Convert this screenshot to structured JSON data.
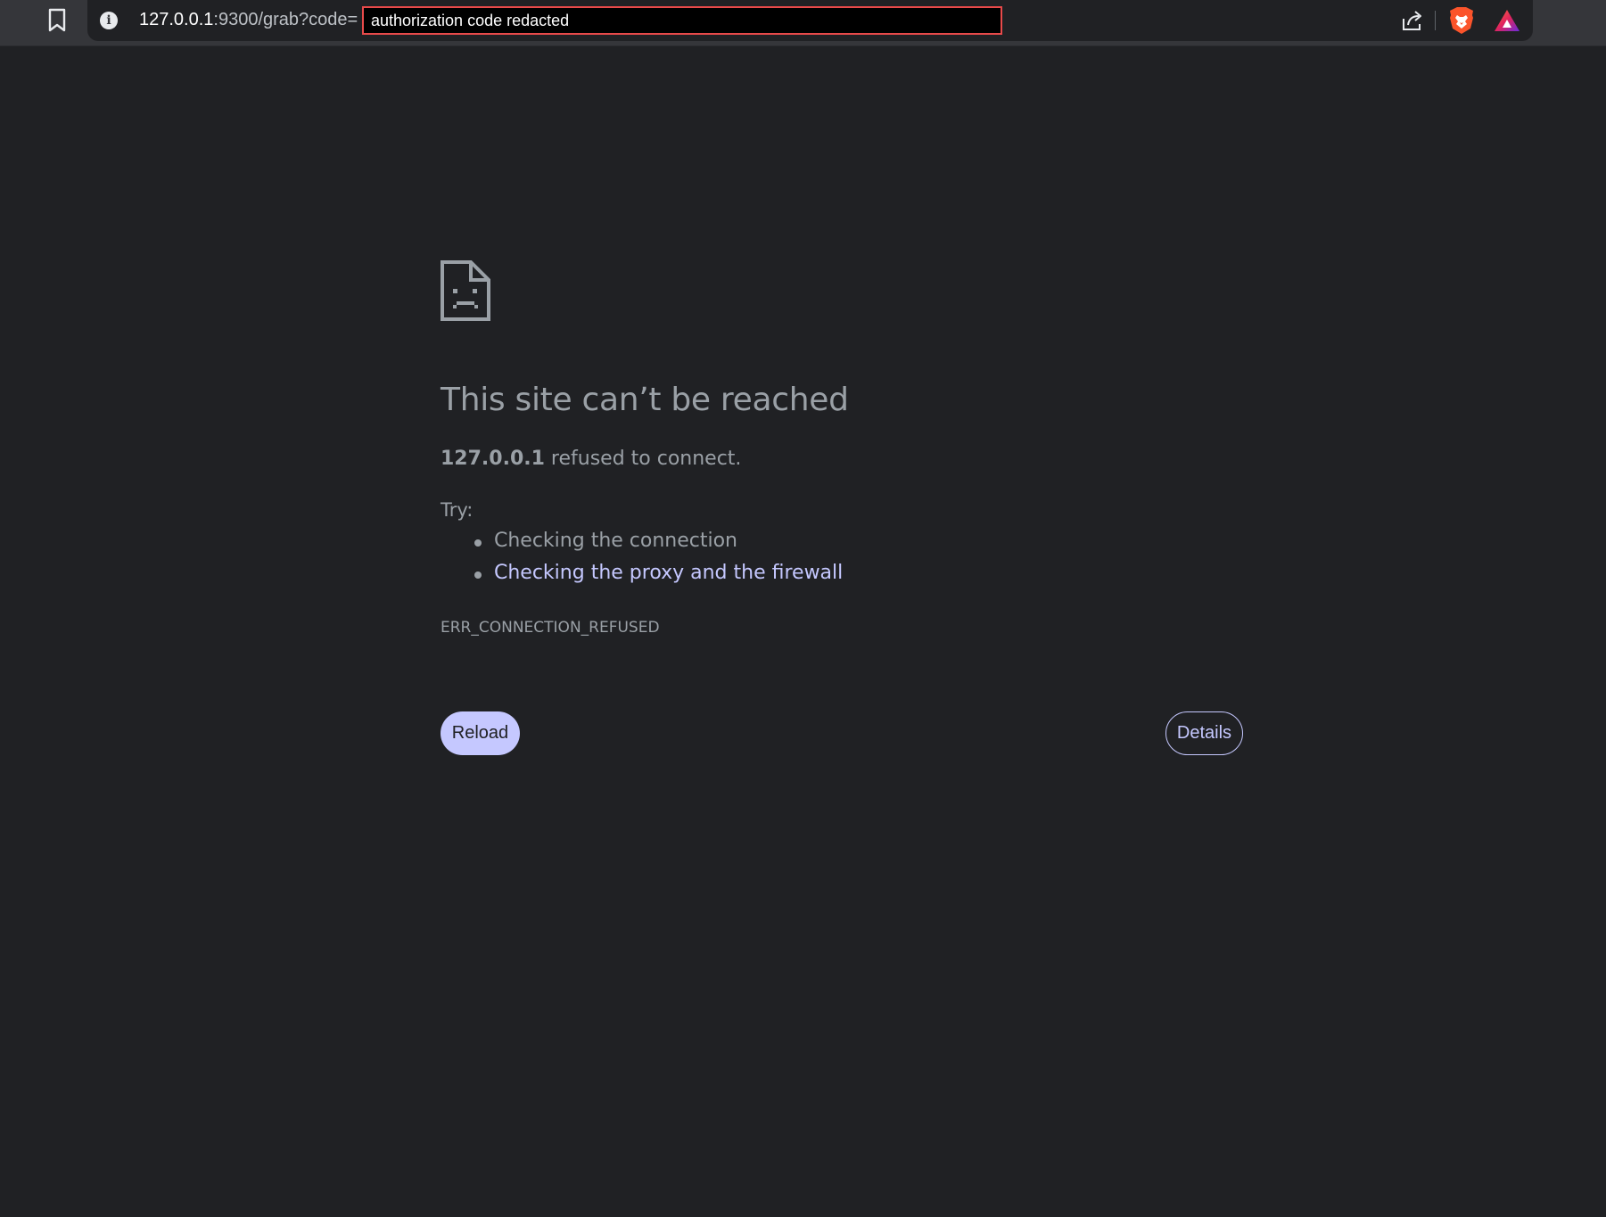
{
  "browser": {
    "url_host": "127.0.0.1",
    "url_path": ":9300/grab?code=",
    "redaction_label": "authorization code redacted",
    "icons": {
      "bookmark": "bookmark-icon",
      "site_info": "info-icon",
      "share": "share-icon",
      "brave_shields": "brave-shields-icon",
      "brave_rewards": "brave-rewards-icon"
    },
    "info_glyph": "i"
  },
  "error_page": {
    "icon": "sad-page-icon",
    "title": "This site can’t be reached",
    "host": "127.0.0.1",
    "summary_rest": " refused to connect.",
    "try_label": "Try:",
    "suggestions": [
      "Checking the connection",
      "Checking the proxy and the firewall"
    ],
    "error_code": "ERR_CONNECTION_REFUSED",
    "reload_label": "Reload",
    "details_label": "Details"
  },
  "colors": {
    "background": "#202124",
    "toolbar": "#35363a",
    "text_secondary": "#9aa0a6",
    "accent": "#c5c8ff",
    "redaction_border": "#e84a4a"
  }
}
